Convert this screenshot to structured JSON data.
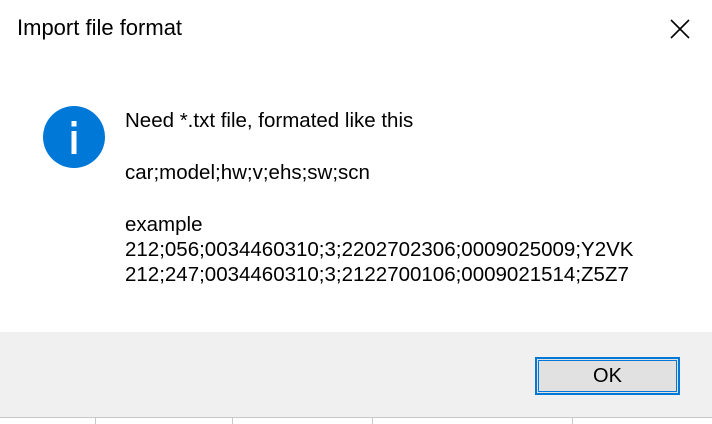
{
  "dialog": {
    "title": "Import file format",
    "close_icon": "close-icon",
    "info_icon": "info-icon",
    "accent_color": "#0078d7",
    "message": {
      "line1": "Need *.txt file, formated like this",
      "line2": "car;model;hw;v;ehs;sw;scn",
      "line3": "example",
      "line4": "212;056;0034460310;3;2202702306;0009025009;Y2VK",
      "line5": "212;247;0034460310;3;2122700106;0009021514;Z5Z7"
    },
    "ok_label": "OK"
  }
}
